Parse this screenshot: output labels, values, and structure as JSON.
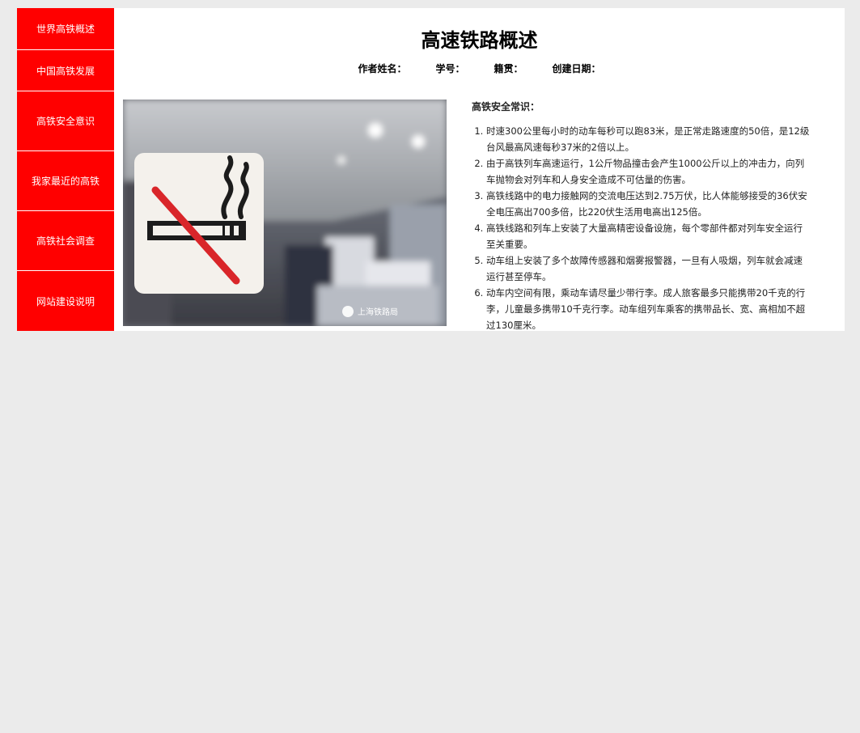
{
  "nav": {
    "items": [
      {
        "label": "世界高铁概述"
      },
      {
        "label": "中国高铁发展"
      },
      {
        "label": "高铁安全意识"
      },
      {
        "label": "我家最近的高铁"
      },
      {
        "label": "高铁社会调查"
      },
      {
        "label": "网站建设说明"
      }
    ]
  },
  "page": {
    "title": "高速铁路概述",
    "meta": {
      "author_label": "作者姓名：",
      "student_id_label": "学号：",
      "origin_label": "籍贯：",
      "date_label": "创建日期："
    }
  },
  "photo": {
    "icon": "no-smoking-sign",
    "watermark": "上海铁路局"
  },
  "tips": {
    "heading": "高铁安全常识：",
    "items": [
      "时速300公里每小时的动车每秒可以跑83米，是正常走路速度的50倍，是12级台风最高风速每秒37米的2倍以上。",
      "由于高铁列车高速运行，1公斤物品撞击会产生1000公斤以上的冲击力，向列车抛物会对列车和人身安全造成不可估量的伤害。",
      "高铁线路中的电力接触网的交流电压达到2.75万伏，比人体能够接受的36伏安全电压高出700多倍，比220伏生活用电高出125倍。",
      "高铁线路和列车上安装了大量高精密设备设施，每个零部件都对列车安全运行至关重要。",
      "动车组上安装了多个故障传感器和烟雾报警器，一旦有人吸烟，列车就会减速运行甚至停车。",
      "动车内空间有限，乘动车请尽量少带行李。成人旅客最多只能携带20千克的行李，儿童最多携带10千克行李。动车组列车乘客的携带品长、宽、高相加不超过130厘米。"
    ]
  },
  "colors": {
    "nav_bg": "#ff0000",
    "page_bg": "#ebebeb",
    "content_bg": "#ffffff"
  }
}
